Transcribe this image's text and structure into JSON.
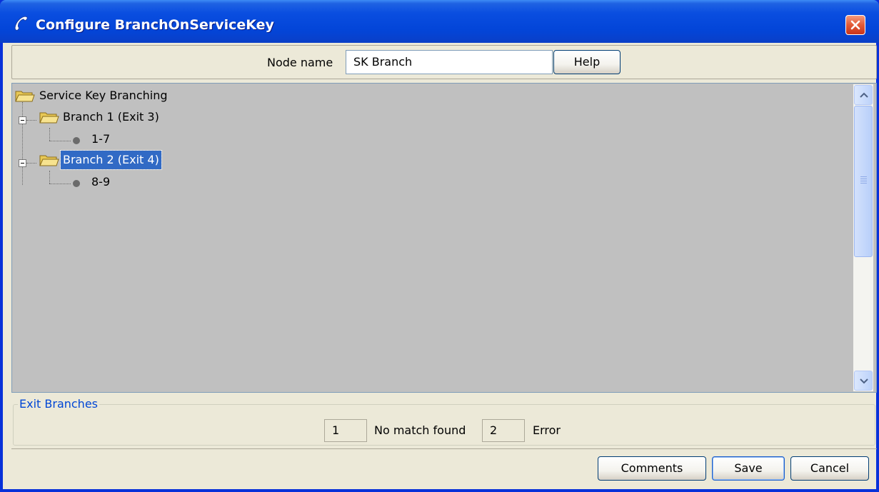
{
  "window": {
    "title": "Configure BranchOnServiceKey",
    "title_icon": "phone-handset-icon",
    "close_icon": "close-icon"
  },
  "node": {
    "label": "Node name",
    "value": "SK Branch",
    "help_label": "Help"
  },
  "tree": {
    "root": "Service Key Branching",
    "branches": [
      {
        "label": "Branch 1 (Exit 3)",
        "leaf": "1-7",
        "selected": false
      },
      {
        "label": "Branch 2 (Exit 4)",
        "leaf": "8-9",
        "selected": true
      }
    ]
  },
  "exit_branches": {
    "legend": "Exit Branches",
    "no_match_value": "1",
    "no_match_label": "No match found",
    "error_value": "2",
    "error_label": "Error"
  },
  "buttons": {
    "comments": "Comments",
    "save": "Save",
    "cancel": "Cancel"
  },
  "colors": {
    "selection": "#316ac5",
    "titlebar": "#0345d8",
    "tree_background": "#c0c0c0",
    "legend_text": "#0046d5"
  }
}
